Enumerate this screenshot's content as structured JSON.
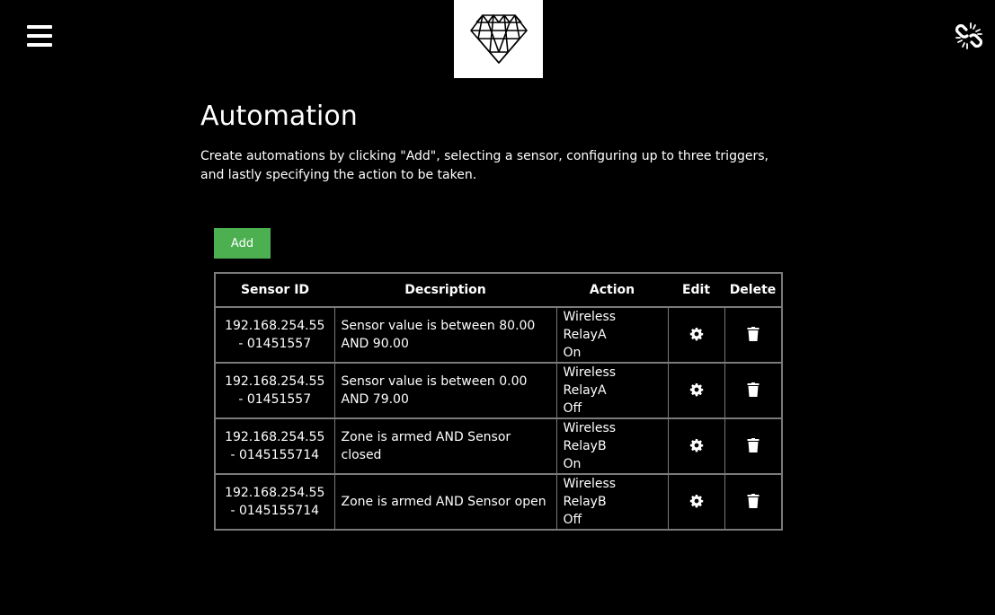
{
  "header": {
    "menu_icon": "hamburger-menu-icon",
    "logo_icon": "diamond-logo",
    "unlink_icon": "broken-link-icon"
  },
  "page": {
    "title": "Automation",
    "intro": "Create automations by clicking \"Add\", selecting a sensor, configuring up to three triggers, and lastly specifying the action to be taken."
  },
  "toolbar": {
    "add_label": "Add",
    "add_color": "#4caf50"
  },
  "table": {
    "headers": {
      "sensor_id": "Sensor ID",
      "description": "Decsription",
      "action": "Action",
      "edit": "Edit",
      "delete": "Delete"
    },
    "rows": [
      {
        "sensor_ip": "192.168.254.55",
        "sensor_num": "- 01451557",
        "desc_line1": "Sensor value is between 80.00",
        "desc_line2": "AND 90.00",
        "action_device": "Wireless RelayA",
        "action_state": "On"
      },
      {
        "sensor_ip": "192.168.254.55",
        "sensor_num": "- 01451557",
        "desc_line1": "Sensor value is between 0.00",
        "desc_line2": "AND 79.00",
        "action_device": "Wireless RelayA",
        "action_state": "Off"
      },
      {
        "sensor_ip": "192.168.254.55",
        "sensor_num": "- 0145155714",
        "desc_line1": "Zone is armed AND Sensor closed",
        "desc_line2": "",
        "action_device": "Wireless RelayB",
        "action_state": "On"
      },
      {
        "sensor_ip": "192.168.254.55",
        "sensor_num": "- 0145155714",
        "desc_line1": "Zone is armed AND Sensor open",
        "desc_line2": "",
        "action_device": "Wireless RelayB",
        "action_state": "Off"
      }
    ],
    "edit_icon": "gear-icon",
    "delete_icon": "trash-icon"
  }
}
